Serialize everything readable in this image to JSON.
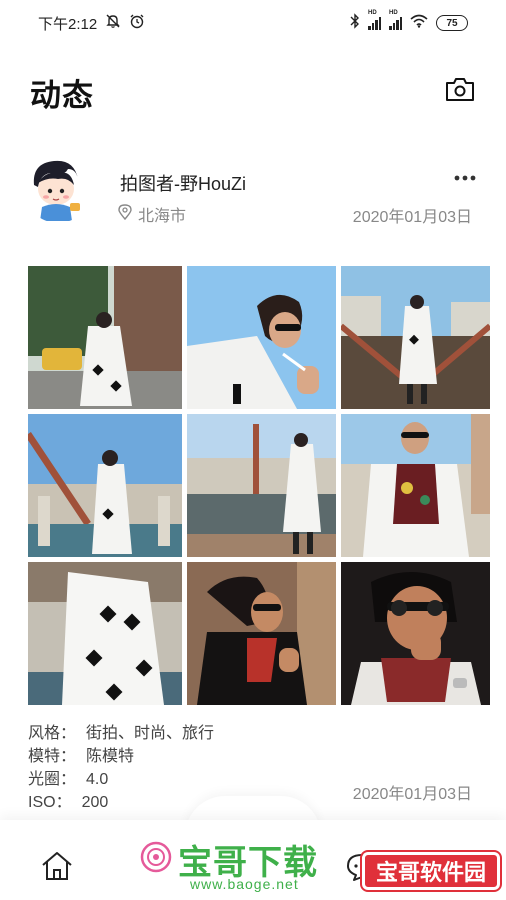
{
  "status_bar": {
    "time": "下午2:12",
    "battery": "75"
  },
  "header": {
    "title": "动态"
  },
  "post": {
    "author": "拍图者-野HouZi",
    "location": "北海市",
    "date": "2020年01月03日",
    "details": [
      {
        "label": "风格：",
        "value": "街拍、时尚、旅行"
      },
      {
        "label": "模特：",
        "value": "陈模特"
      },
      {
        "label": "光圈：",
        "value": "4.0"
      },
      {
        "label": "ISO：",
        "value": "200"
      }
    ],
    "date_footer": "2020年01月03日"
  },
  "watermarks": {
    "brand": "宝哥下载",
    "url": "www.baoge.net",
    "badge": "宝哥软件园"
  },
  "icons": {
    "camera": "camera-icon",
    "more": "more-icon",
    "location": "location-pin-icon",
    "home": "home-icon",
    "chat": "chat-icon",
    "me": "user-icon"
  }
}
